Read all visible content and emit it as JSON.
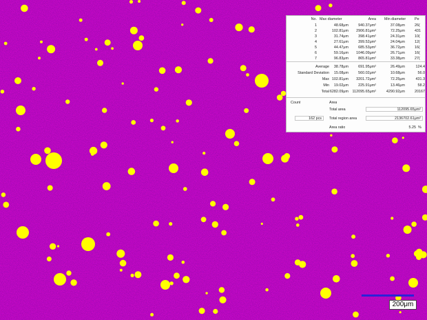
{
  "colors": {
    "matrix": "#a0129f",
    "phase": "#ffff00",
    "panel_bg": "#fdfdfd",
    "scale_bar": "#2a22d8"
  },
  "table": {
    "headers": [
      "No.",
      "Max diameter",
      "Area",
      "Min diameter",
      "Pe"
    ],
    "rows": [
      [
        "1",
        "48.68μm",
        "940.37μm²",
        "37.08μm",
        "26("
      ],
      [
        "2",
        "102.81μm",
        "2906.81μm²",
        "72.25μm",
        "431"
      ],
      [
        "3",
        "31.74μm",
        "398.41μm²",
        "24.31μm",
        "10("
      ],
      [
        "4",
        "27.61μm",
        "399.52μm²",
        "24.04μm",
        "12("
      ],
      [
        "5",
        "44.47μm",
        "685.53μm²",
        "36.72μm",
        "16("
      ],
      [
        "6",
        "59.16μm",
        "1046.09μm²",
        "26.71μm",
        "16("
      ],
      [
        "7",
        "96.83μm",
        "865.81μm²",
        "33.38μm",
        "27("
      ]
    ]
  },
  "stats": [
    {
      "label": "Average",
      "values": [
        "38.78μm",
        "691.95μm²",
        "26.49μm",
        "124.4"
      ]
    },
    {
      "label": "Standard Deviation",
      "values": [
        "15.08μm",
        "560.02μm²",
        "10.68μm",
        "56.0"
      ]
    },
    {
      "label": "Max",
      "values": [
        "102.81μm",
        "3201.72μm²",
        "72.25μm",
        "431.3"
      ]
    },
    {
      "label": "Min",
      "values": [
        "19.02μm",
        "225.91μm²",
        "13.46μm",
        "58.2"
      ]
    },
    {
      "label": "Total",
      "values": [
        "6282.09μm",
        "112095.65μm²",
        "4290.92μm",
        "20167.3"
      ]
    }
  ],
  "count": {
    "label": "Count",
    "value": "162",
    "unit": "pcs"
  },
  "area": {
    "label": "Area",
    "total_area_label": "Total area",
    "total_area": "112095.65μm²",
    "total_region_label": "Total region area",
    "total_region": "2136702.61μm²",
    "ratio_label": "Area ratio",
    "ratio": "5.25",
    "ratio_unit": "%"
  },
  "scale_bar": {
    "label": "200μm"
  }
}
